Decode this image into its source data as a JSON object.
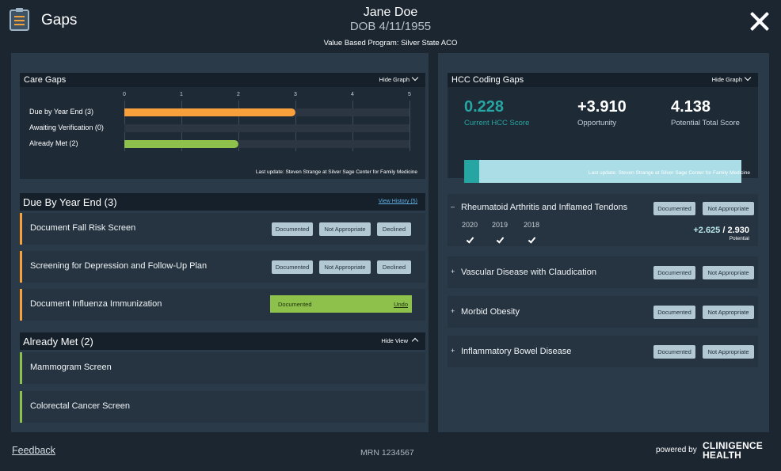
{
  "header": {
    "app_icon": "clipboard-list-icon",
    "title": "Gaps",
    "patient_name": "Jane Doe",
    "dob": "DOB 4/11/1955",
    "program": "Value Based Program:  Silver State ACO",
    "close_icon": "close-icon"
  },
  "care_gaps": {
    "title": "Care Gaps",
    "hide_graph": "Hide Graph",
    "last_update": "Last update: Steven Strange at  Silver Sage Center for Family Medicine",
    "chart_data": {
      "type": "bar",
      "orientation": "horizontal",
      "categories": [
        "Due by Year End (3)",
        "Awaiting Verification (0)",
        "Already Met (2)"
      ],
      "values": [
        3,
        0,
        2
      ],
      "colors": [
        "#f7a03c",
        "#8dc14b",
        "#8dc14b"
      ],
      "xticks": [
        "0",
        "1",
        "2",
        "3",
        "4",
        "5"
      ],
      "xlim": [
        0,
        5
      ],
      "grid": true
    }
  },
  "due": {
    "title": "Due By Year End (3)",
    "history_link": "View History (5)",
    "accent": "#f7a03c",
    "items": [
      {
        "label": "Document Fall Risk Screen",
        "btn1": "Documented",
        "btn2": "Not Appropriate",
        "btn3": "Declined"
      },
      {
        "label": "Screening for Depression and Follow-Up Plan",
        "btn1": "Documented",
        "btn2": "Not Appropriate",
        "btn3": "Declined"
      },
      {
        "label": "Document Influenza Immunization",
        "status": "Documented",
        "undo": "Undo"
      }
    ]
  },
  "met": {
    "title": "Already Met (2)",
    "hide_view": "Hide View",
    "accent": "#8dc14b",
    "items": [
      {
        "label": "Mammogram Screen"
      },
      {
        "label": "Colorectal Cancer Screen"
      }
    ]
  },
  "hcc": {
    "title": "HCC Coding Gaps",
    "hide_graph": "Hide Graph",
    "current_score": "0.228",
    "current_label": "Current HCC Score",
    "opportunity": "+3.910",
    "opportunity_label": "Opportunity",
    "potential_total": "4.138",
    "potential_label": "Potential Total Score",
    "current_fraction": 0.055,
    "last_update": "Last update: Steven Strange at  Silver Sage Center for Family Medicine",
    "colors": {
      "current": "#27a5a3",
      "opportunity": "#aadde6",
      "score": "#27a5a3"
    },
    "conditions": [
      {
        "sign": "–",
        "name": "Rheumatoid Arthritis and Inflamed Tendons",
        "btn1": "Documented",
        "btn2": "Not Appropriate",
        "years": [
          "2020",
          "2019",
          "2018"
        ],
        "potential_gain": "+2.625",
        "potential_sep": " / ",
        "potential_total": "2.930",
        "potential_label": "Potential"
      },
      {
        "sign": "+",
        "name": "Vascular Disease with Claudication",
        "btn1": "Documented",
        "btn2": "Not Appropriate"
      },
      {
        "sign": "+",
        "name": "Morbid Obesity",
        "btn1": "Documented",
        "btn2": "Not Appropriate"
      },
      {
        "sign": "+",
        "name": "Inflammatory Bowel Disease",
        "btn1": "Documented",
        "btn2": "Not Appropriate"
      }
    ]
  },
  "footer": {
    "feedback": "Feedback",
    "mrn": "MRN 1234567",
    "powered_by": "powered by",
    "logo_line1": "CLINIGENCE",
    "logo_line2": "HEALTH"
  }
}
